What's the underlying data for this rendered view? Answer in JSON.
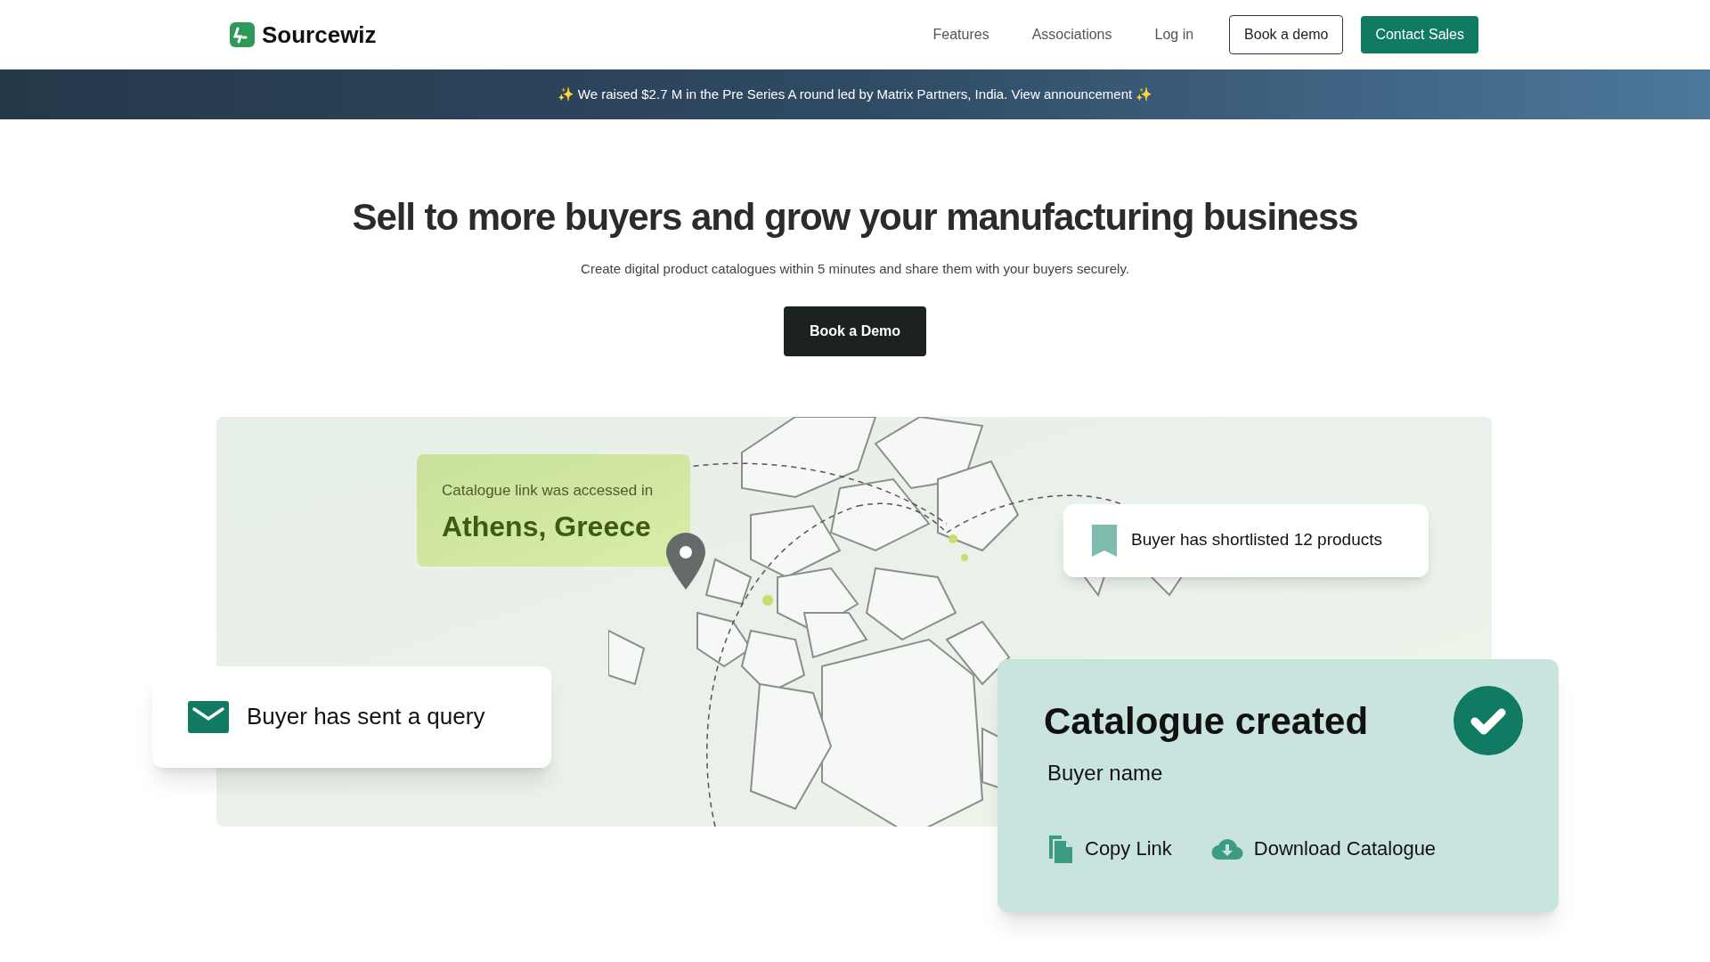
{
  "header": {
    "logo_text": "Sourcewiz",
    "nav": [
      {
        "label": "Features",
        "kind": "link"
      },
      {
        "label": "Associations",
        "kind": "link"
      },
      {
        "label": "Log in",
        "kind": "link"
      },
      {
        "label": "Book a demo",
        "kind": "outline"
      },
      {
        "label": "Contact Sales",
        "kind": "primary"
      }
    ]
  },
  "announcement": "✨ We raised $2.7 M in the Pre Series A round led by Matrix Partners, India. View announcement ✨",
  "hero": {
    "title": "Sell to more buyers and grow your manufacturing business",
    "subtitle": "Create digital product catalogues within 5 minutes and share them with your buyers securely.",
    "button": "Book a Demo"
  },
  "illustration": {
    "location_card": {
      "caption": "Catalogue link was accessed in",
      "city": "Athens, Greece"
    },
    "shortlist_card": "Buyer has shortlisted 12 products",
    "query_card": "Buyer has sent a query",
    "catalogue_card": {
      "title": "Catalogue created",
      "buyer": "Buyer name",
      "actions": [
        {
          "label": "Copy Link",
          "kind": "copy"
        },
        {
          "label": "Download Catalogue",
          "kind": "download"
        }
      ]
    }
  }
}
